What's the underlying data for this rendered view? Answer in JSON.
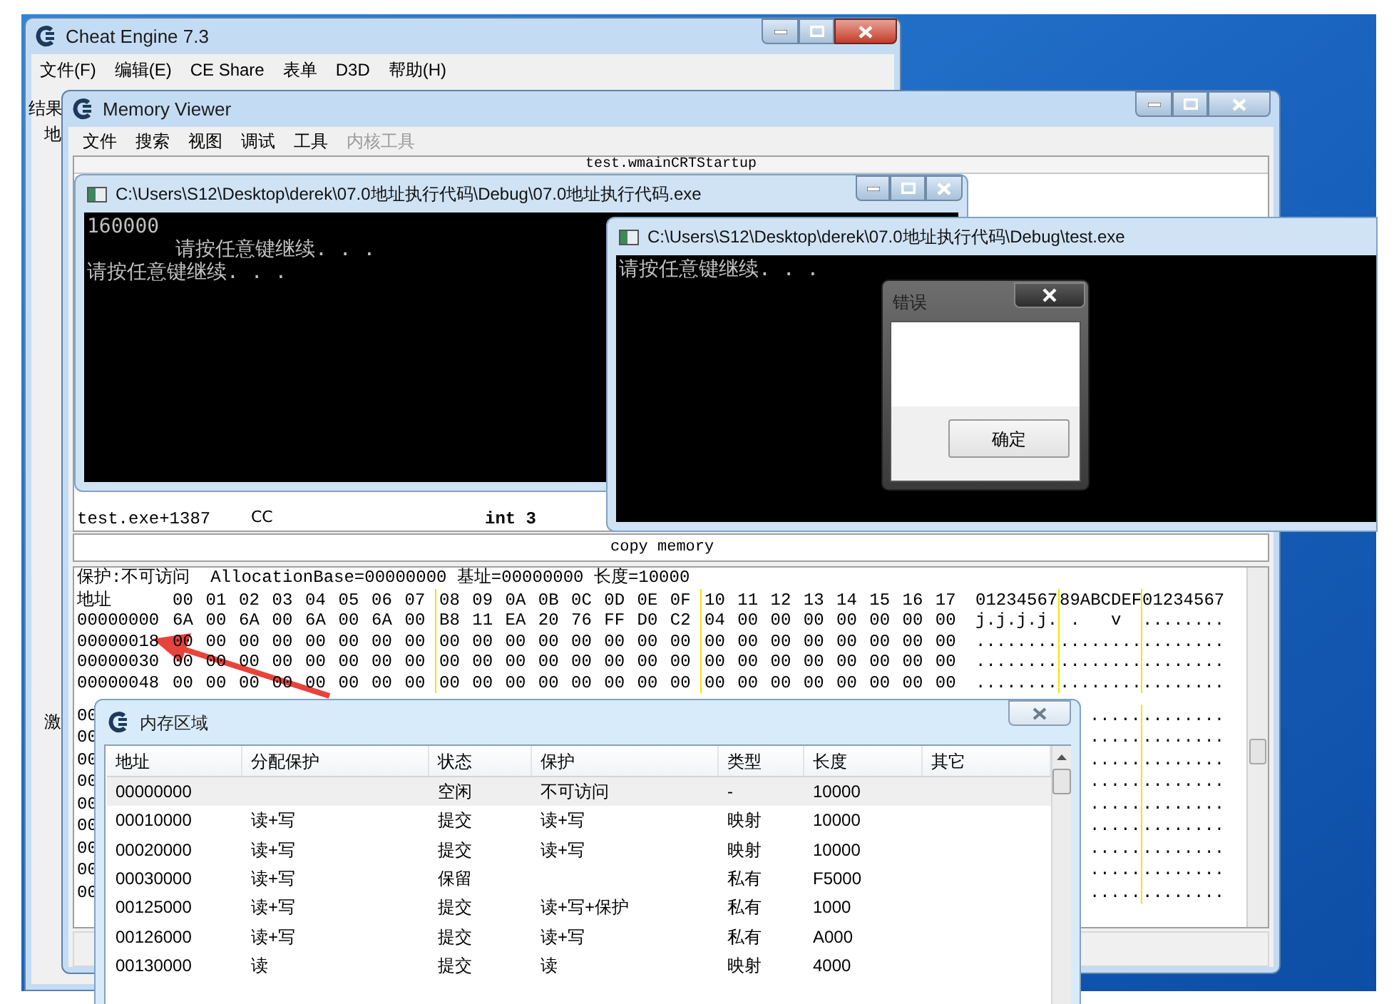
{
  "cheat_engine": {
    "title": "Cheat Engine 7.3",
    "menu": [
      "文件(F)",
      "编辑(E)",
      "CE Share",
      "表单",
      "D3D",
      "帮助(H)"
    ],
    "side_labels": [
      "结果",
      "地",
      "激"
    ]
  },
  "memory_viewer": {
    "title": "Memory Viewer",
    "menu": [
      {
        "label": "文件",
        "disabled": false
      },
      {
        "label": "搜索",
        "disabled": false
      },
      {
        "label": "视图",
        "disabled": false
      },
      {
        "label": "调试",
        "disabled": false
      },
      {
        "label": "工具",
        "disabled": false
      },
      {
        "label": "内核工具",
        "disabled": true
      }
    ],
    "disassembly": {
      "header": "test.wmainCRTStartup",
      "rows": [
        {
          "address": "test.exe+1387",
          "bytes": "CC",
          "opcode": "int 3"
        }
      ],
      "comment": "copy memory"
    },
    "hex_view": {
      "info": "保护:不可访问  AllocationBase=00000000 基址=00000000 长度=10000",
      "header": {
        "address": "地址",
        "byte_groups": [
          "00 01 02 03 04 05 06 07",
          "08 09 0A 0B 0C 0D 0E 0F",
          "10 11 12 13 14 15 16 17"
        ],
        "ascii_groups": [
          "01234567",
          "89ABCDEF",
          "01234567"
        ]
      },
      "rows": [
        {
          "kind": "full",
          "address": "00000000",
          "byte_groups": [
            "6A 00 6A 00 6A 00 6A 00",
            "B8 11 EA 20 76 FF D0 C2",
            "04 00 00 00 00 00 00 00"
          ],
          "ascii_groups": [
            "j.j.j.j.",
            " .   v",
            "........"
          ]
        },
        {
          "kind": "full",
          "address": "00000018",
          "byte_groups": [
            "00 00 00 00 00 00 00 00",
            "00 00 00 00 00 00 00 00",
            "00 00 00 00 00 00 00 00"
          ],
          "ascii_groups": [
            "........",
            "........",
            "........"
          ]
        },
        {
          "kind": "full",
          "address": "00000030",
          "byte_groups": [
            "00 00 00 00 00 00 00 00",
            "00 00 00 00 00 00 00 00",
            "00 00 00 00 00 00 00 00"
          ],
          "ascii_groups": [
            "........",
            "........",
            "........"
          ]
        },
        {
          "kind": "full",
          "address": "00000048",
          "byte_groups": [
            "00 00 00 00 00 00 00 00",
            "00 00 00 00 00 00 00 00",
            "00 00 00 00 00 00 00 00"
          ],
          "ascii_groups": [
            "........",
            "........",
            "........"
          ]
        },
        {
          "kind": "covered",
          "address": "00",
          "ascii_groups": [
            ".....",
            "........"
          ]
        },
        {
          "kind": "covered",
          "address": "00",
          "ascii_groups": [
            ".....",
            "........"
          ]
        },
        {
          "kind": "covered",
          "address": "00",
          "ascii_groups": [
            ".....",
            "........"
          ]
        },
        {
          "kind": "covered",
          "address": "00",
          "ascii_groups": [
            ".....",
            "........"
          ]
        },
        {
          "kind": "covered",
          "address": "00",
          "ascii_groups": [
            ".....",
            "........"
          ]
        },
        {
          "kind": "covered",
          "address": "00",
          "ascii_groups": [
            ".....",
            "........"
          ]
        },
        {
          "kind": "covered",
          "address": "00",
          "ascii_groups": [
            ".....",
            "........"
          ]
        },
        {
          "kind": "covered",
          "address": "00",
          "ascii_groups": [
            ".....",
            "........"
          ]
        },
        {
          "kind": "covered",
          "address": "00",
          "ascii_groups": [
            ".....",
            "........"
          ]
        }
      ]
    }
  },
  "console_windows": [
    {
      "title": "C:\\Users\\S12\\Desktop\\derek\\07.0地址执行代码\\Debug\\07.0地址执行代码.exe",
      "lines": [
        {
          "text": "160000",
          "indented": false
        },
        {
          "text": "请按任意键继续. . .",
          "indented": true
        },
        {
          "text": "请按任意键继续. . .",
          "indented": false
        }
      ]
    },
    {
      "title": "C:\\Users\\S12\\Desktop\\derek\\07.0地址执行代码\\Debug\\test.exe",
      "lines": [
        {
          "text": "请按任意键继续. . .",
          "indented": false
        }
      ]
    }
  ],
  "error_dialog": {
    "title": "错误",
    "button": "确定"
  },
  "memory_regions": {
    "title": "内存区域",
    "columns": [
      "地址",
      "分配保护",
      "状态",
      "保护",
      "类型",
      "长度",
      "其它"
    ],
    "rows": [
      {
        "selected": true,
        "address": "00000000",
        "state": "空闲",
        "protect": "不可访问",
        "type": "-",
        "size": "10000"
      },
      {
        "selected": false,
        "address": "00010000",
        "alloc_protect": "读+写",
        "state": "提交",
        "protect": "读+写",
        "type": "映射",
        "size": "10000"
      },
      {
        "selected": false,
        "address": "00020000",
        "alloc_protect": "读+写",
        "state": "提交",
        "protect": "读+写",
        "type": "映射",
        "size": "10000"
      },
      {
        "selected": false,
        "address": "00030000",
        "alloc_protect": "读+写",
        "state": "保留",
        "type": "私有",
        "size": "F5000"
      },
      {
        "selected": false,
        "address": "00125000",
        "alloc_protect": "读+写",
        "state": "提交",
        "protect": "读+写+保护",
        "type": "私有",
        "size": "1000"
      },
      {
        "selected": false,
        "address": "00126000",
        "alloc_protect": "读+写",
        "state": "提交",
        "protect": "读+写",
        "type": "私有",
        "size": "A000"
      },
      {
        "selected": false,
        "address": "00130000",
        "alloc_protect": "读",
        "state": "提交",
        "protect": "读",
        "type": "映射",
        "size": "4000"
      }
    ]
  }
}
